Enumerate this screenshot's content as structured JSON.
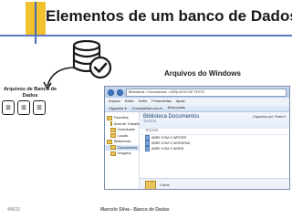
{
  "slide": {
    "title": "Elementos de um banco de Dados",
    "db_files_label": "Arquivos de Banco de Dados",
    "windows_label": "Arquivos do Windows",
    "footer_date": "4/8/23",
    "footer_center": "Marcelo Silva - Banco de Dados"
  },
  "icons": {
    "database": "database-check-icon",
    "arrow": "curved-arrow-icon",
    "file": "file-icon"
  },
  "explorer": {
    "address": "Bibliotecas > Documentos > ARQUIVOS DE TEXTO",
    "menu": [
      "Arquivo",
      "Editar",
      "Exibir",
      "Ferramentas",
      "Ajuda"
    ],
    "toolbar": [
      "Organizar ▾",
      "Compartilhar com ▾",
      "Nova pasta"
    ],
    "nav": [
      {
        "label": "Favoritos",
        "child": false,
        "selected": false
      },
      {
        "label": "Área de Trabalho",
        "child": true,
        "selected": false
      },
      {
        "label": "Downloads",
        "child": true,
        "selected": false
      },
      {
        "label": "Locais",
        "child": true,
        "selected": false
      },
      {
        "label": "Bibliotecas",
        "child": false,
        "selected": false
      },
      {
        "label": "Documentos",
        "child": true,
        "selected": true
      },
      {
        "label": "Imagens",
        "child": true,
        "selected": false
      }
    ],
    "library_title": "Biblioteca Documentos",
    "library_sub": "TEXTOS",
    "arrange_label": "Organizar por: Pasta ▾",
    "column_header": "TEXTOS",
    "files": [
      "ABRE COM O WRITER",
      "ABRE COM O WORDPAD",
      "ABRE COM O WORD"
    ],
    "details": "4 itens"
  },
  "colors": {
    "accent_yellow": "#f2c12e",
    "accent_blue": "#5a78c4",
    "window_frame": "#dfe9f5"
  }
}
